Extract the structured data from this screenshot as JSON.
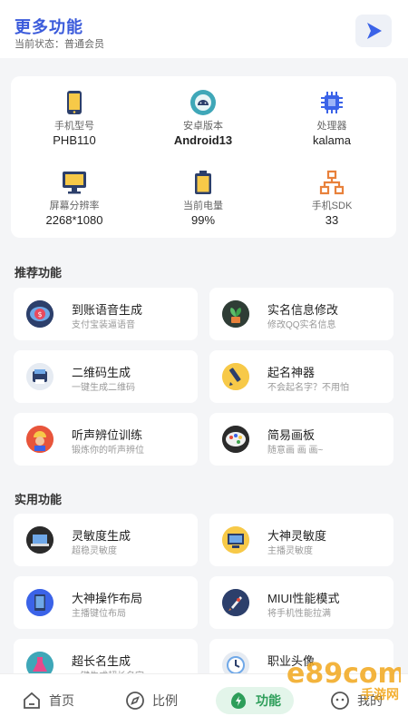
{
  "header": {
    "title": "更多功能",
    "status": "当前状态：普通会员",
    "play_icon": "play-icon"
  },
  "device_info": [
    {
      "label": "手机型号",
      "value": "PHB110",
      "icon": "phone-icon"
    },
    {
      "label": "安卓版本",
      "value": "Android13",
      "icon": "android-icon"
    },
    {
      "label": "处理器",
      "value": "kalama",
      "icon": "chip-icon"
    },
    {
      "label": "屏幕分辨率",
      "value": "2268*1080",
      "icon": "monitor-icon"
    },
    {
      "label": "当前电量",
      "value": "99%",
      "icon": "battery-icon"
    },
    {
      "label": "手机SDK",
      "value": "33",
      "icon": "network-icon"
    }
  ],
  "sections": {
    "recommended": {
      "title": "推荐功能",
      "items": [
        {
          "name": "到账语音生成",
          "desc": "支付宝装逼语音",
          "icon": "coin-icon"
        },
        {
          "name": "实名信息修改",
          "desc": "修改QQ实名信息",
          "icon": "plant-icon"
        },
        {
          "name": "二维码生成",
          "desc": "一键生成二维码",
          "icon": "qrcode-icon"
        },
        {
          "name": "起名神器",
          "desc": "不会起名字？不用怕",
          "icon": "pen-icon"
        },
        {
          "name": "听声辨位训练",
          "desc": "锻炼你的听声辨位",
          "icon": "worker-icon"
        },
        {
          "name": "简易画板",
          "desc": "随意画 画 画~",
          "icon": "palette-icon"
        }
      ]
    },
    "practical": {
      "title": "实用功能",
      "items": [
        {
          "name": "灵敏度生成",
          "desc": "超稳灵敏度",
          "icon": "laptop-icon"
        },
        {
          "name": "大神灵敏度",
          "desc": "主播灵敏度",
          "icon": "computer-icon"
        },
        {
          "name": "大神操作布局",
          "desc": "主播键位布局",
          "icon": "tablet-icon"
        },
        {
          "name": "MIUI性能模式",
          "desc": "将手机性能拉满",
          "icon": "rocket-icon"
        },
        {
          "name": "超长名生成",
          "desc": "一键生成超长名字",
          "icon": "flask-icon"
        },
        {
          "name": "职业头像",
          "desc": "",
          "icon": "clock-icon"
        }
      ]
    }
  },
  "bottom_nav": [
    {
      "label": "首页",
      "icon": "home-icon",
      "active": false
    },
    {
      "label": "比例",
      "icon": "compass-icon",
      "active": false
    },
    {
      "label": "功能",
      "icon": "bolt-icon",
      "active": true
    },
    {
      "label": "我的",
      "icon": "face-icon",
      "active": false
    }
  ],
  "watermark": {
    "text": "手游网",
    "logo": "e89com"
  }
}
